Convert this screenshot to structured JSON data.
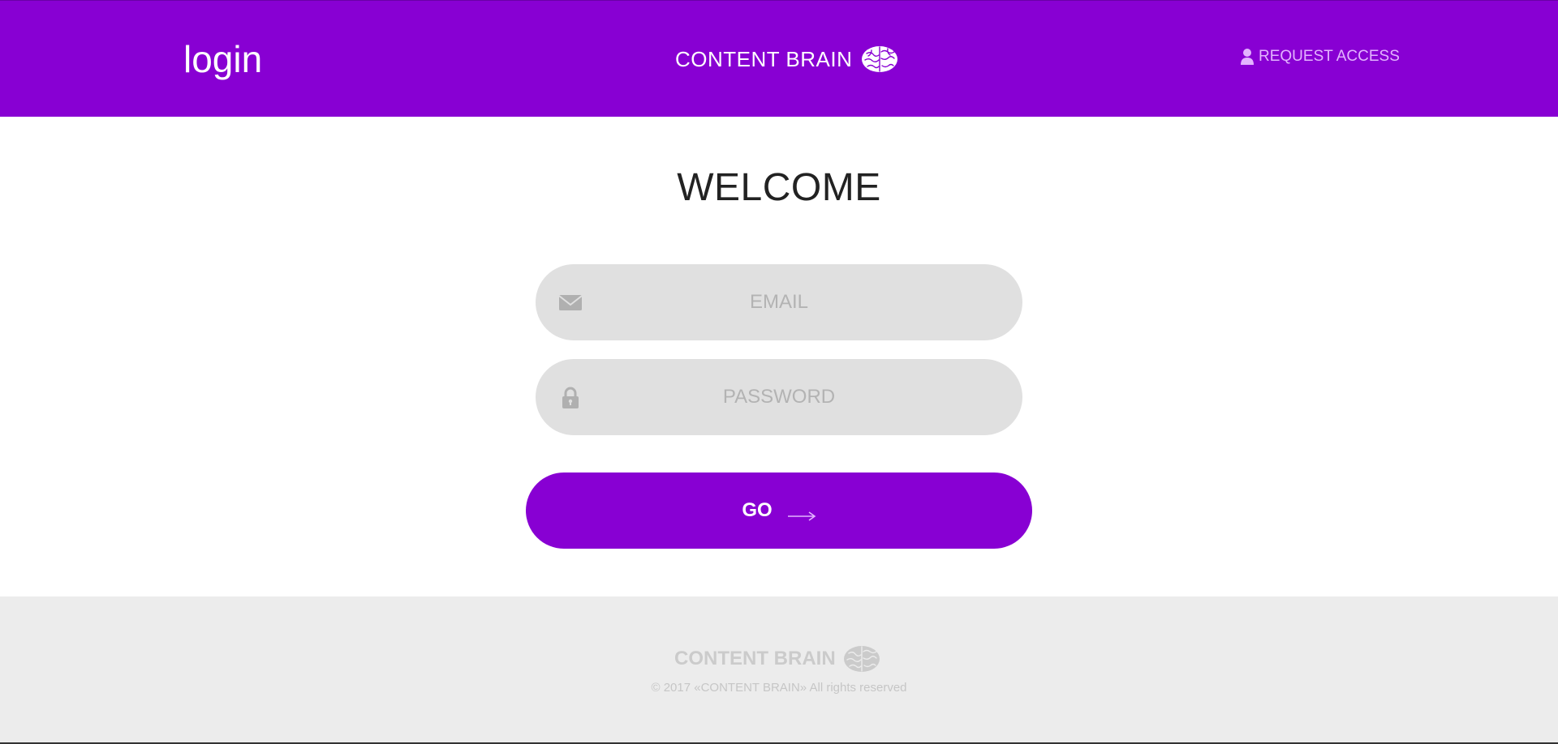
{
  "header": {
    "title": "login",
    "brand": "CONTENT BRAIN",
    "brand_icon": "brain-icon",
    "request_access": "REQUEST ACCESS",
    "request_icon": "person-icon",
    "background": "#8800d3"
  },
  "main": {
    "heading": "WELCOME",
    "email": {
      "placeholder": "EMAIL",
      "value": "",
      "icon": "envelope-icon"
    },
    "password": {
      "placeholder": "PASSWORD",
      "value": "",
      "icon": "lock-icon"
    },
    "submit_label": "GO",
    "submit_icon": "arrow-right-icon"
  },
  "footer": {
    "brand": "CONTENT BRAIN",
    "copyright": "© 2017 «CONTENT BRAIN» All rights reserved"
  },
  "colors": {
    "accent": "#8800d3",
    "field_bg": "#e0e0e0",
    "footer_bg": "#ececec"
  }
}
